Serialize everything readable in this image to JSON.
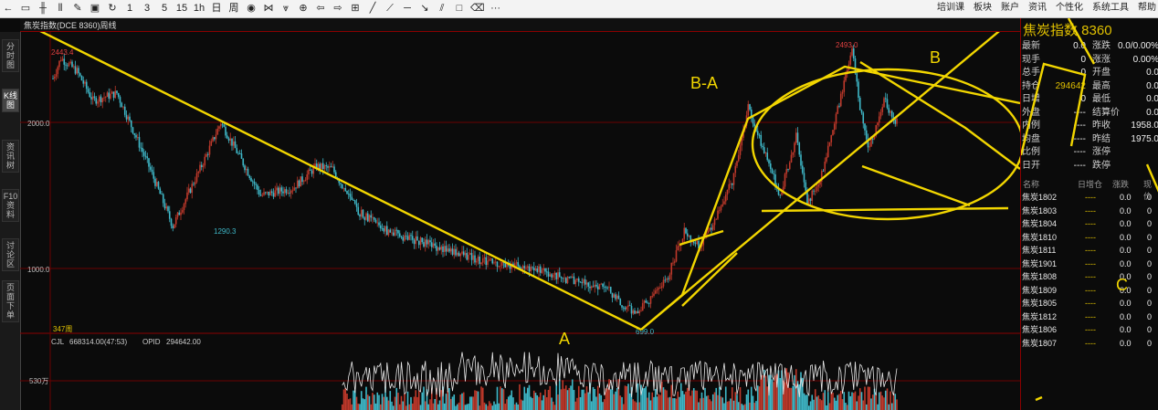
{
  "toolbar": {
    "numbers": [
      "1",
      "3",
      "5",
      "15",
      "1h",
      "日",
      "周"
    ],
    "menus": [
      "培训课",
      "板块",
      "账户",
      "资讯",
      "个性化",
      "系统工具",
      "帮助"
    ]
  },
  "title": "焦炭指数(DCE 8360)周线",
  "sidebar": {
    "tabs": [
      "分时图",
      "K线图",
      "资讯树",
      "F10资料",
      "讨论区",
      "页面下单"
    ],
    "active": "K线图"
  },
  "price_axis": {
    "labels": [
      "2000.0",
      "1000.0"
    ]
  },
  "annotations": {
    "high_start": "2443.4",
    "low_mid": "1290.3",
    "low_A": "699.0",
    "high_B": "2493.0",
    "bar_count": "347周",
    "drawn_A": "A",
    "drawn_BA": "B-A",
    "drawn_B": "B",
    "drawn_C": "C"
  },
  "volume": {
    "info_label": "CJL",
    "info_value": "668314.00(47:53)",
    "opid_label": "OPID",
    "opid_value": "294642.00",
    "axis_label": "530万"
  },
  "quote": {
    "title": "焦炭指数 8360",
    "rows_left": [
      {
        "label": "最新",
        "value": "0.0"
      },
      {
        "label": "现手",
        "value": "0"
      },
      {
        "label": "总手",
        "value": "0"
      },
      {
        "label": "持仓",
        "value": "294642"
      },
      {
        "label": "日增",
        "value": "0"
      },
      {
        "label": "外盘",
        "value": "----"
      },
      {
        "label": "内例",
        "value": "----"
      },
      {
        "label": "均盘",
        "value": "----"
      },
      {
        "label": "比例",
        "value": "----"
      },
      {
        "label": "日开",
        "value": "----"
      }
    ],
    "rows_right": [
      {
        "label": "涨跌",
        "value": "0.0/0.00%"
      },
      {
        "label": "涨涨",
        "value": "0.00%"
      },
      {
        "label": "开盘",
        "value": "0.0"
      },
      {
        "label": "最高",
        "value": "0.0"
      },
      {
        "label": "最低",
        "value": "0.0"
      },
      {
        "label": "结算价",
        "value": "0.0"
      },
      {
        "label": "昨收",
        "value": "1958.0"
      },
      {
        "label": "昨结",
        "value": "1975.0"
      },
      {
        "label": "涨停",
        "value": ""
      },
      {
        "label": "跌停",
        "value": ""
      }
    ]
  },
  "contracts": {
    "headers": [
      "名称",
      "日增仓",
      "涨跌",
      "现价"
    ],
    "rows": [
      {
        "name": "焦炭1802",
        "oi": "----",
        "chg": "0.0",
        "px": "0"
      },
      {
        "name": "焦炭1803",
        "oi": "----",
        "chg": "0.0",
        "px": "0"
      },
      {
        "name": "焦炭1804",
        "oi": "----",
        "chg": "0.0",
        "px": "0"
      },
      {
        "name": "焦炭1810",
        "oi": "----",
        "chg": "0.0",
        "px": "0"
      },
      {
        "name": "焦炭1811",
        "oi": "----",
        "chg": "0.0",
        "px": "0"
      },
      {
        "name": "焦炭1901",
        "oi": "----",
        "chg": "0.0",
        "px": "0"
      },
      {
        "name": "焦炭1808",
        "oi": "----",
        "chg": "0.0",
        "px": "0"
      },
      {
        "name": "焦炭1809",
        "oi": "----",
        "chg": "0.0",
        "px": "0"
      },
      {
        "name": "焦炭1805",
        "oi": "----",
        "chg": "0.0",
        "px": "0"
      },
      {
        "name": "焦炭1812",
        "oi": "----",
        "chg": "0.0",
        "px": "0"
      },
      {
        "name": "焦炭1806",
        "oi": "----",
        "chg": "0.0",
        "px": "0"
      },
      {
        "name": "焦炭1807",
        "oi": "----",
        "chg": "0.0",
        "px": "0"
      }
    ]
  },
  "colors": {
    "up": "#c0392b",
    "down": "#3fb8c8",
    "drawing": "#f2d600",
    "grid": "#6b0000"
  }
}
